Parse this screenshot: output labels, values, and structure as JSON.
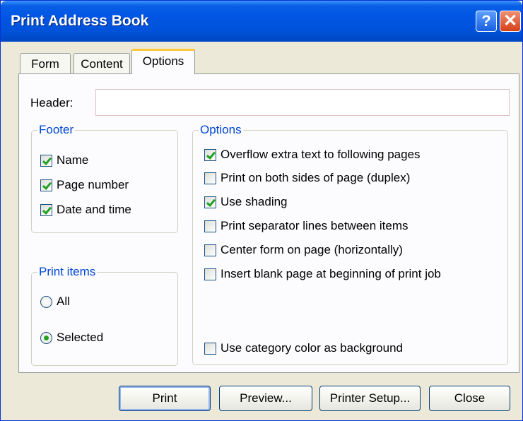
{
  "window": {
    "title": "Print Address Book",
    "help_glyph": "?",
    "close_glyph": "✕"
  },
  "tabs": [
    {
      "label": "Form",
      "selected": false
    },
    {
      "label": "Content",
      "selected": false
    },
    {
      "label": "Options",
      "selected": true
    }
  ],
  "header": {
    "label": "Header:",
    "value": ""
  },
  "footer": {
    "title": "Footer",
    "items": [
      {
        "label": "Name",
        "checked": true
      },
      {
        "label": "Page number",
        "checked": true
      },
      {
        "label": "Date and time",
        "checked": true
      }
    ]
  },
  "print_items": {
    "title": "Print items",
    "options": [
      {
        "label": "All",
        "selected": false
      },
      {
        "label": "Selected",
        "selected": true
      }
    ]
  },
  "options": {
    "title": "Options",
    "items": [
      {
        "label": "Overflow extra text to following pages",
        "checked": true
      },
      {
        "label": "Print on both sides of page (duplex)",
        "checked": false
      },
      {
        "label": "Use shading",
        "checked": true
      },
      {
        "label": "Print separator lines between items",
        "checked": false
      },
      {
        "label": "Center form on page (horizontally)",
        "checked": false
      },
      {
        "label": "Insert blank page at beginning of print job",
        "checked": false
      }
    ],
    "category_color": {
      "label": "Use category color as background",
      "checked": false
    }
  },
  "buttons": {
    "print": "Print",
    "preview": "Preview...",
    "printer_setup": "Printer Setup...",
    "close": "Close"
  },
  "colors": {
    "titlebar": "#0055e3",
    "group_title": "#0046d5",
    "check": "#21a121",
    "selected_tab_accent": "#ffc83c"
  }
}
